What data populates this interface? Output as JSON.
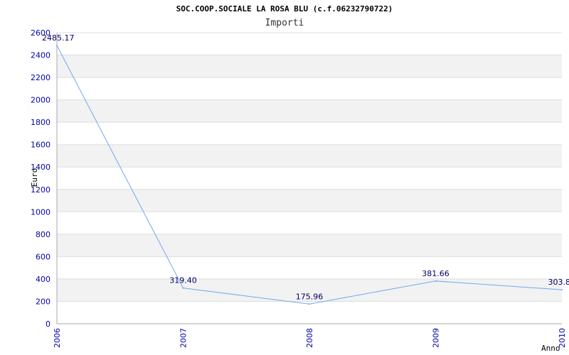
{
  "chart_data": {
    "type": "line",
    "title": "SOC.COOP.SOCIALE LA ROSA BLU (c.f.06232790722)",
    "subtitle": "Importi",
    "xlabel": "Anno",
    "ylabel": "Euro",
    "categories": [
      "2006",
      "2007",
      "2008",
      "2009",
      "2010"
    ],
    "values": [
      2485.17,
      319.4,
      175.96,
      381.66,
      303.8
    ],
    "data_labels": [
      "2485.17",
      "319.40",
      "175.96",
      "381.66",
      "303.8"
    ],
    "y_ticks": [
      "0",
      "200",
      "400",
      "600",
      "800",
      "1000",
      "1200",
      "1400",
      "1600",
      "1800",
      "2000",
      "2200",
      "2400",
      "2600"
    ],
    "ylim": [
      0,
      2600
    ],
    "grid": true,
    "line_color": "#6fa8f0",
    "band_color": "#f2f2f2",
    "tick_color": "#0000aa"
  }
}
